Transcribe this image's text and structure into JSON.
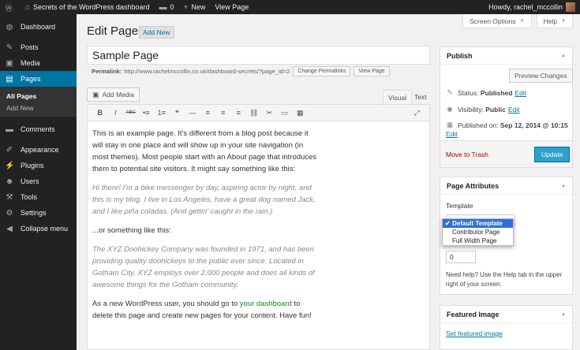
{
  "admin_bar": {
    "site_name": "Secrets of the WordPress dashboard",
    "comments_count": "0",
    "new_label": "New",
    "view_page_label": "View Page",
    "howdy": "Howdy, rachel_mccollin"
  },
  "sidebar": {
    "items": [
      {
        "label": "Dashboard",
        "icon": "dashboard-icon",
        "glyph": "◍"
      },
      {
        "label": "Posts",
        "icon": "pin-icon",
        "glyph": "✎"
      },
      {
        "label": "Media",
        "icon": "media-icon",
        "glyph": "▣"
      },
      {
        "label": "Pages",
        "icon": "pages-icon",
        "glyph": "▤"
      },
      {
        "label": "Comments",
        "icon": "comments-icon",
        "glyph": "▬"
      },
      {
        "label": "Appearance",
        "icon": "brush-icon",
        "glyph": "✐"
      },
      {
        "label": "Plugins",
        "icon": "plug-icon",
        "glyph": "⚡"
      },
      {
        "label": "Users",
        "icon": "users-icon",
        "glyph": "☻"
      },
      {
        "label": "Tools",
        "icon": "wrench-icon",
        "glyph": "⚒"
      },
      {
        "label": "Settings",
        "icon": "sliders-icon",
        "glyph": "⚙"
      },
      {
        "label": "Collapse menu",
        "icon": "collapse-icon",
        "glyph": "◀"
      }
    ],
    "submenu": [
      "All Pages",
      "Add New"
    ]
  },
  "screen_meta": {
    "screen_options": "Screen Options",
    "help": "Help"
  },
  "header": {
    "title": "Edit Page",
    "add_new": "Add New"
  },
  "editor": {
    "post_title": "Sample Page",
    "permalink_label": "Permalink:",
    "permalink_url": "http://www.rachelmccollin.co.uk/dashboard-secrets/?page_id=2",
    "change_permalinks": "Change Permalinks",
    "view_page": "View Page",
    "add_media": "Add Media",
    "tab_visual": "Visual",
    "tab_text": "Text",
    "toolbar": [
      {
        "glyph": "B",
        "name": "bold-icon"
      },
      {
        "glyph": "I",
        "name": "italic-icon"
      },
      {
        "glyph": "ABC",
        "name": "strikethrough-icon"
      },
      {
        "glyph": "•≡",
        "name": "bullet-list-icon"
      },
      {
        "glyph": "1≡",
        "name": "numbered-list-icon"
      },
      {
        "glyph": "❝",
        "name": "blockquote-icon"
      },
      {
        "glyph": "—",
        "name": "horizontal-rule-icon"
      },
      {
        "glyph": "≡",
        "name": "align-left-icon"
      },
      {
        "glyph": "≡",
        "name": "align-center-icon"
      },
      {
        "glyph": "≡",
        "name": "align-right-icon"
      },
      {
        "glyph": "⛓",
        "name": "link-icon"
      },
      {
        "glyph": "✂",
        "name": "unlink-icon"
      },
      {
        "glyph": "▭",
        "name": "read-more-icon"
      },
      {
        "glyph": "▦",
        "name": "toolbar-toggle-icon"
      }
    ],
    "fullscreen_glyph": "⤢",
    "paragraphs": {
      "p1": "This is an example page. It's different from a blog post because it will stay in one place and will show up in your site navigation (in most themes). Most people start with an About page that introduces them to potential site visitors. It might say something like this:",
      "q1": "Hi there! I'm a bike messenger by day, aspiring actor by night, and this is my blog. I live in Los Angeles, have a great dog named Jack, and I like piña coladas. (And gettin' caught in the rain.)",
      "p2": "...or something like this:",
      "q2": "The XYZ Doohickey Company was founded in 1971, and has been providing quality doohickeys to the public ever since. Located in Gotham City, XYZ employs over 2,000 people and does all kinds of awesome things for the Gotham community.",
      "p3_before": "As a new WordPress user, you should go to ",
      "p3_link": "your dashboard",
      "p3_after": " to delete this page and create new pages for your content. Have fun!"
    }
  },
  "publish": {
    "title": "Publish",
    "preview": "Preview Changes",
    "status_label": "Status:",
    "status_value": "Published",
    "visibility_label": "Visibility:",
    "visibility_value": "Public",
    "published_label": "Published on:",
    "published_value": "Sep 12, 2014 @ 10:15",
    "edit": "Edit",
    "trash": "Move to Trash",
    "update": "Update"
  },
  "page_attributes": {
    "title": "Page Attributes",
    "template_label": "Template",
    "options": [
      "Default Template",
      "Contributor Page",
      "Full Width Page"
    ],
    "selected_check": "✔",
    "order_value": "0",
    "help": "Need help? Use the Help tab in the upper right of your screen."
  },
  "featured_image": {
    "title": "Featured Image",
    "link": "Set featured image"
  },
  "colors": {
    "accent": "#0074a2",
    "update_button": "#2ea2cc",
    "adminbar": "#222222",
    "trash": "#aa0000"
  }
}
